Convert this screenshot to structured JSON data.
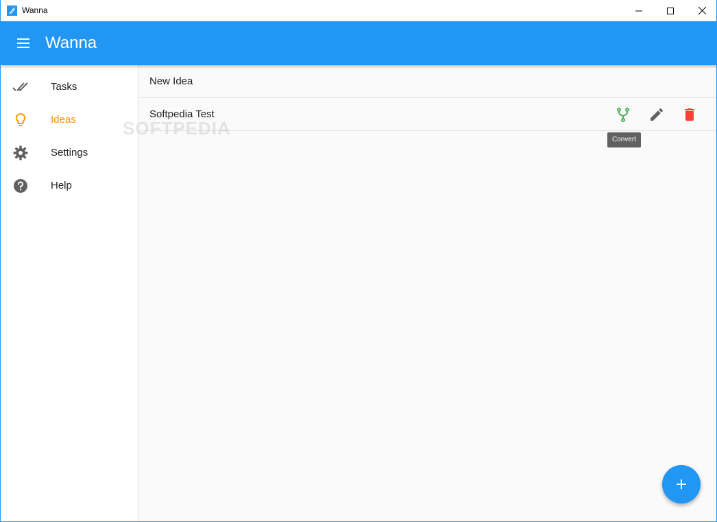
{
  "window": {
    "title": "Wanna",
    "icon": "app-logo-icon",
    "controls": [
      "minimize-icon",
      "maximize-icon",
      "close-icon"
    ]
  },
  "appbar": {
    "title": "Wanna",
    "menu_icon": "hamburger-menu-icon"
  },
  "sidebar": {
    "items": [
      {
        "label": "Tasks",
        "icon": "double-check-icon",
        "active": false
      },
      {
        "label": "Ideas",
        "icon": "lightbulb-icon",
        "active": true
      },
      {
        "label": "Settings",
        "icon": "gear-icon",
        "active": false
      },
      {
        "label": "Help",
        "icon": "help-circle-icon",
        "active": false
      }
    ]
  },
  "main": {
    "new_item_label": "New Idea",
    "ideas": [
      {
        "label": "Softpedia Test",
        "actions": [
          "fork-icon",
          "pencil-icon",
          "trash-icon"
        ]
      }
    ],
    "tooltip": "Convert"
  },
  "watermark": "SOFTPEDIA",
  "fab": {
    "icon": "plus-icon"
  },
  "colors": {
    "primary": "#2196f3",
    "accent_active": "#ff8f00",
    "convert": "#4caf50",
    "delete": "#f44336",
    "icon_gray": "#616161"
  }
}
